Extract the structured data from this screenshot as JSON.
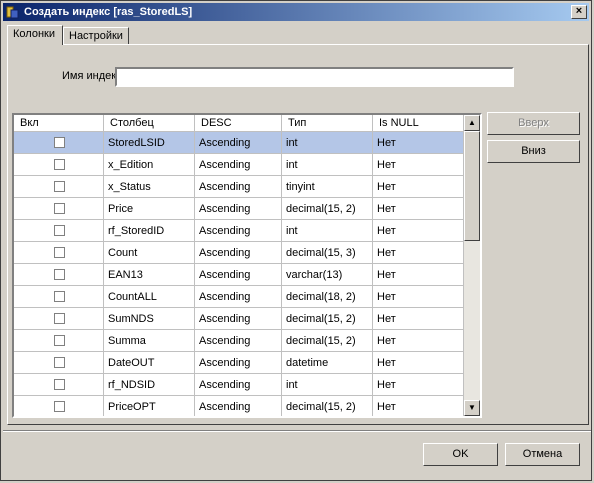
{
  "window": {
    "title": "Создать индекс [ras_StoredLS]",
    "close_glyph": "×"
  },
  "tabs": [
    {
      "label": "Колонки"
    },
    {
      "label": "Настройки"
    }
  ],
  "index_name": {
    "label": "Имя индекса:",
    "value": ""
  },
  "grid": {
    "headers": [
      "Вкл",
      "Столбец",
      "DESC",
      "Тип",
      "Is NULL"
    ],
    "rows": [
      {
        "column": "StoredLSID",
        "desc": "Ascending",
        "type": "int",
        "is_null": "Нет",
        "checked": false,
        "selected": true
      },
      {
        "column": "x_Edition",
        "desc": "Ascending",
        "type": "int",
        "is_null": "Нет",
        "checked": false
      },
      {
        "column": "x_Status",
        "desc": "Ascending",
        "type": "tinyint",
        "is_null": "Нет",
        "checked": false
      },
      {
        "column": "Price",
        "desc": "Ascending",
        "type": "decimal(15, 2)",
        "is_null": "Нет",
        "checked": false
      },
      {
        "column": "rf_StoredID",
        "desc": "Ascending",
        "type": "int",
        "is_null": "Нет",
        "checked": false
      },
      {
        "column": "Count",
        "desc": "Ascending",
        "type": "decimal(15, 3)",
        "is_null": "Нет",
        "checked": false
      },
      {
        "column": "EAN13",
        "desc": "Ascending",
        "type": "varchar(13)",
        "is_null": "Нет",
        "checked": false
      },
      {
        "column": "CountALL",
        "desc": "Ascending",
        "type": "decimal(18, 2)",
        "is_null": "Нет",
        "checked": false
      },
      {
        "column": "SumNDS",
        "desc": "Ascending",
        "type": "decimal(15, 2)",
        "is_null": "Нет",
        "checked": false
      },
      {
        "column": "Summa",
        "desc": "Ascending",
        "type": "decimal(15, 2)",
        "is_null": "Нет",
        "checked": false
      },
      {
        "column": "DateOUT",
        "desc": "Ascending",
        "type": "datetime",
        "is_null": "Нет",
        "checked": false
      },
      {
        "column": "rf_NDSID",
        "desc": "Ascending",
        "type": "int",
        "is_null": "Нет",
        "checked": false
      },
      {
        "column": "PriceOPT",
        "desc": "Ascending",
        "type": "decimal(15, 2)",
        "is_null": "Нет",
        "checked": false
      }
    ]
  },
  "side_buttons": {
    "up": "Вверх",
    "down": "Вниз"
  },
  "footer": {
    "ok": "OK",
    "cancel": "Отмена"
  },
  "colors": {
    "title_start": "#0a246a",
    "title_end": "#a6caf0",
    "selected_row": "#b4c6e7",
    "face": "#d4d0c8"
  }
}
